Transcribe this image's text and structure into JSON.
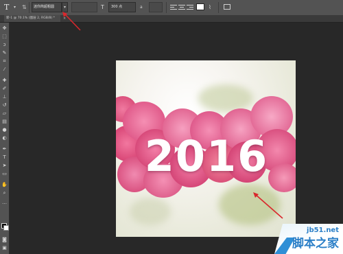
{
  "options_bar": {
    "tool_icon": "T",
    "tool_icon_name": "type-tool-icon",
    "font_family_value": "迷你简超粗圆",
    "font_size_value": "300 点",
    "text_color": "#ffffff"
  },
  "document": {
    "tab_title": "新-1 @ 70.1% (图层 2, RGB/8) *",
    "year_text": "2016"
  },
  "watermark": {
    "url": "jb51.net",
    "name": "脚本之家"
  },
  "colors": {
    "workspace": "#282828",
    "panel": "#535353",
    "arrow": "#d9272c",
    "flower_pink": "#e8457a",
    "brand_blue": "#2b7fc7"
  }
}
